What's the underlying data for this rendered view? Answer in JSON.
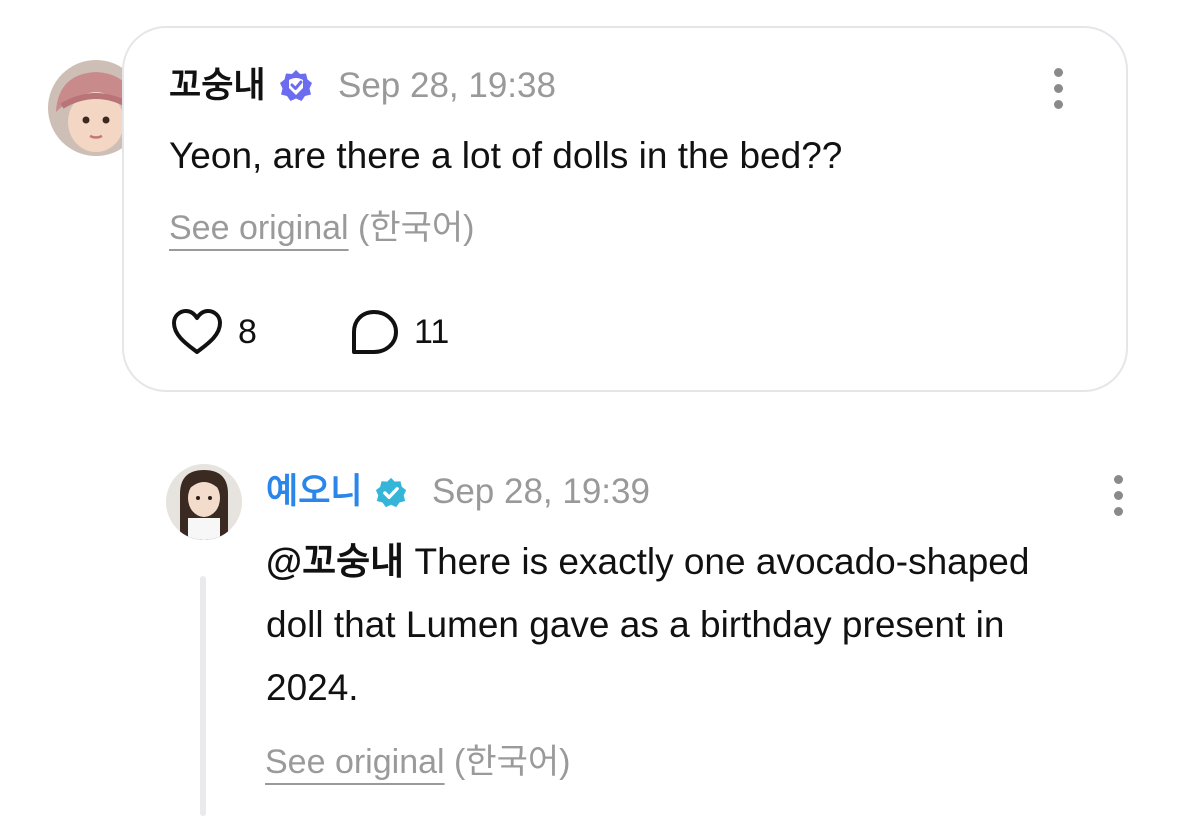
{
  "comment": {
    "author": "꼬숭내",
    "timestamp": "Sep 28, 19:38",
    "text": "Yeon, are there a lot of dolls in the bed??",
    "see_original_label": "See original",
    "language": "(한국어)",
    "like_count": "8",
    "reply_count": "11",
    "badge_color": "#6b6cf0"
  },
  "reply": {
    "author": "예오니",
    "timestamp": "Sep 28, 19:39",
    "mention": "@꼬숭내",
    "text": " There is exactly one avocado-shaped doll that Lumen gave as a birthday present in 2024.",
    "see_original_label": "See original",
    "language": "(한국어)",
    "author_color": "#2a86e8",
    "badge_color": "#35b6d9"
  }
}
